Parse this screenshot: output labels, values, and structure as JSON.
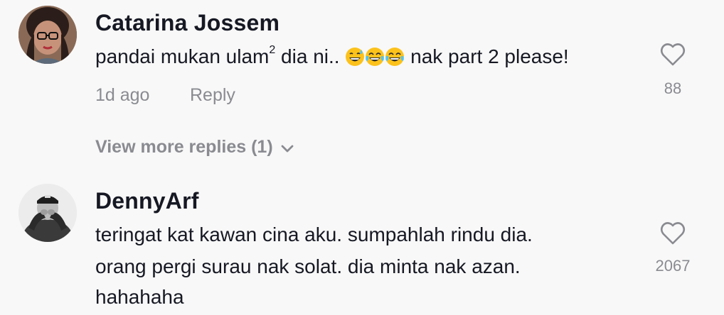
{
  "comments": [
    {
      "username": "Catarina Jossem",
      "text_before": "pandai mukan ulam",
      "superscript": "2",
      "text_middle": " dia ni.. ",
      "emojis": [
        "grinning-sweat-emoji",
        "tears-of-joy-emoji",
        "tears-of-joy-emoji"
      ],
      "text_after": " nak part 2 please!",
      "time": "1d ago",
      "reply_label": "Reply",
      "likes": "88",
      "view_more_replies": "View more replies (1)"
    },
    {
      "username": "DennyArf",
      "lines": [
        "teringat kat kawan cina aku. sumpahlah rindu dia.",
        "orang pergi surau nak solat. dia minta nak azan.",
        "hahahaha"
      ],
      "likes": "2067"
    }
  ],
  "colors": {
    "background": "#f8f8f8",
    "primary_text": "#161823",
    "secondary_text": "#8a8b91"
  }
}
